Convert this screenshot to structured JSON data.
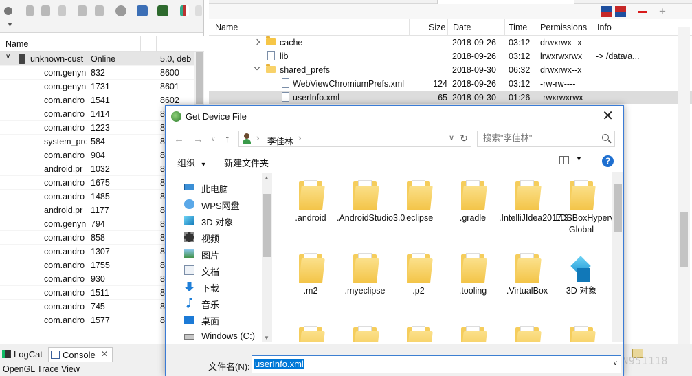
{
  "devices": {
    "headers": {
      "name": "Name"
    },
    "device": {
      "name": "unknown-cust",
      "state": "Online",
      "version": "5.0, deb"
    },
    "processes": [
      {
        "name": "com.genyn",
        "pid": "832",
        "port": "8600"
      },
      {
        "name": "com.genyn",
        "pid": "1731",
        "port": "8601"
      },
      {
        "name": "com.andro",
        "pid": "1541",
        "port": "8602"
      },
      {
        "name": "com.andro",
        "pid": "1414",
        "port": "8"
      },
      {
        "name": "com.andro",
        "pid": "1223",
        "port": "8"
      },
      {
        "name": "system_prc",
        "pid": "584",
        "port": "8"
      },
      {
        "name": "com.andro",
        "pid": "904",
        "port": "8"
      },
      {
        "name": "android.pr",
        "pid": "1032",
        "port": "8"
      },
      {
        "name": "com.andro",
        "pid": "1675",
        "port": "8"
      },
      {
        "name": "com.andro",
        "pid": "1485",
        "port": "8"
      },
      {
        "name": "android.pr",
        "pid": "1177",
        "port": "8"
      },
      {
        "name": "com.genyn",
        "pid": "794",
        "port": "8"
      },
      {
        "name": "com.andro",
        "pid": "858",
        "port": "8"
      },
      {
        "name": "com.andro",
        "pid": "1307",
        "port": "8"
      },
      {
        "name": "com.andro",
        "pid": "1755",
        "port": "8"
      },
      {
        "name": "com.andro",
        "pid": "930",
        "port": "8"
      },
      {
        "name": "com.andro",
        "pid": "1511",
        "port": "8"
      },
      {
        "name": "com.andro",
        "pid": "745",
        "port": "8"
      },
      {
        "name": "com.andro",
        "pid": "1577",
        "port": "8"
      }
    ]
  },
  "explorer": {
    "headers": {
      "name": "Name",
      "size": "Size",
      "date": "Date",
      "time": "Time",
      "permissions": "Permissions",
      "info": "Info"
    },
    "rows": [
      {
        "name": "cache",
        "size": "",
        "date": "2018-09-26",
        "time": "03:12",
        "perm": "drwxrwx--x",
        "info": ""
      },
      {
        "name": "lib",
        "size": "",
        "date": "2018-09-26",
        "time": "03:12",
        "perm": "lrwxrwxrwx",
        "info": "-> /data/a..."
      },
      {
        "name": "shared_prefs",
        "size": "",
        "date": "2018-09-30",
        "time": "06:32",
        "perm": "drwxrwx--x",
        "info": ""
      },
      {
        "name": "WebViewChromiumPrefs.xml",
        "size": "124",
        "date": "2018-09-26",
        "time": "03:12",
        "perm": "-rw-rw----",
        "info": ""
      },
      {
        "name": "userInfo.xml",
        "size": "65",
        "date": "2018-09-30",
        "time": "01:26",
        "perm": "-rwxrwxrwx",
        "info": ""
      }
    ]
  },
  "bottom": {
    "tabs": [
      {
        "label": "LogCat"
      },
      {
        "label": "Console"
      }
    ],
    "view_title": "OpenGL Trace View",
    "watermark": "https://blog.csdn.net/JN951118"
  },
  "dialog": {
    "title": "Get Device File",
    "address": {
      "path": "李佳林"
    },
    "search": {
      "placeholder": "搜索\"李佳林\""
    },
    "commands": {
      "organize": "组织",
      "new_folder": "新建文件夹"
    },
    "nav": [
      {
        "label": "此电脑",
        "icon": "computer-icon"
      },
      {
        "label": "WPS网盘",
        "icon": "cloud-icon"
      },
      {
        "label": "3D 对象",
        "icon": "3d-objects-icon"
      },
      {
        "label": "视频",
        "icon": "video-icon"
      },
      {
        "label": "图片",
        "icon": "pictures-icon"
      },
      {
        "label": "文档",
        "icon": "documents-icon"
      },
      {
        "label": "下载",
        "icon": "download-icon"
      },
      {
        "label": "音乐",
        "icon": "music-icon"
      },
      {
        "label": "桌面",
        "icon": "desktop-icon"
      },
      {
        "label": "Windows (C:)",
        "icon": "drive-icon"
      }
    ],
    "folders": [
      {
        "label": ".android"
      },
      {
        "label": ".AndroidStudio3.0"
      },
      {
        "label": ".eclipse"
      },
      {
        "label": ".gradle"
      },
      {
        "label": ".IntelliJIdea2017.3"
      },
      {
        "label": ".LDSBoxHypervisor Global"
      },
      {
        "label": ".m2"
      },
      {
        "label": ".myeclipse"
      },
      {
        "label": ".p2"
      },
      {
        "label": ".tooling"
      },
      {
        "label": ".VirtualBox"
      },
      {
        "label": "3D 对象"
      }
    ],
    "filename_label": "文件名(N):",
    "filename_value": "userInfo.xml"
  }
}
